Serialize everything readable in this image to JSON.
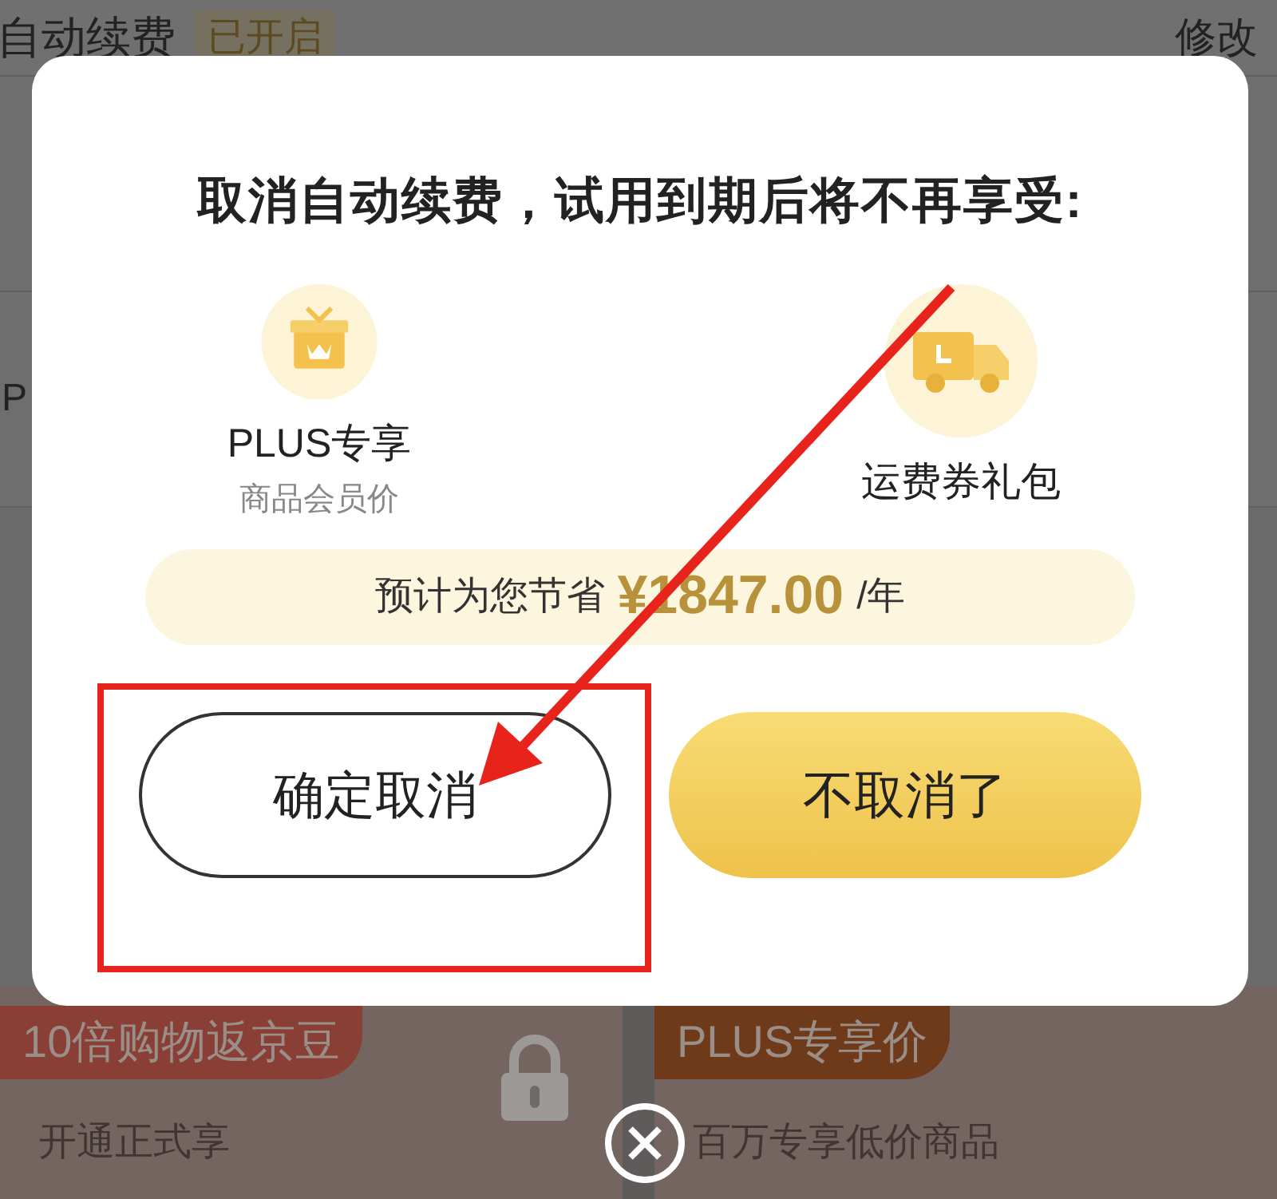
{
  "background": {
    "renewal_label": "自动续费",
    "renewal_status": "已开启",
    "edit_link": "修改",
    "row_fragments": [
      "P"
    ],
    "cards": [
      {
        "tag": "10倍购物返京豆",
        "text": "开通正式享",
        "locked": true,
        "color": "#8a3f36"
      },
      {
        "tag": "PLUS专享价",
        "text": "百万专享低价商品",
        "locked": false,
        "color": "#6f3a1a"
      }
    ]
  },
  "dialog": {
    "title": "取消自动续费，试用到期后将不再享受:",
    "benefits": [
      {
        "kind": "gift",
        "label": "PLUS专享",
        "sublabel": "商品会员价"
      },
      {
        "kind": "truck",
        "label": "运费券礼包"
      }
    ],
    "savings": {
      "prefix": "预计为您节省",
      "amount": "¥1847.00",
      "suffix": "/年"
    },
    "buttons": [
      {
        "label": "确定取消",
        "kind": "outline"
      },
      {
        "label": "不取消了",
        "kind": "primary"
      }
    ]
  }
}
